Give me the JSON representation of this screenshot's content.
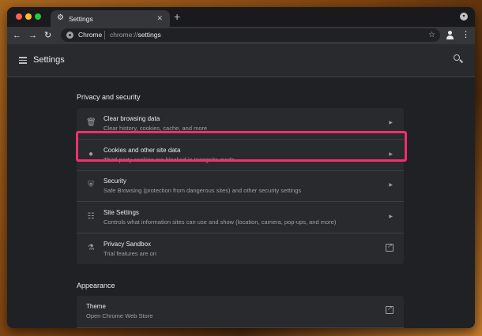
{
  "tab": {
    "title": "Settings",
    "icon": "gear-icon",
    "close_icon": "close-icon"
  },
  "new_tab_icon": "plus-icon",
  "toolbar": {
    "back_icon": "back-arrow-icon",
    "forward_icon": "forward-arrow-icon",
    "reload_icon": "reload-icon",
    "omnibox_label": "Chrome",
    "url_scheme": "chrome://",
    "url_path": "settings",
    "bookmark_icon": "star-icon",
    "profile_icon": "person-icon",
    "menu_icon": "more-vert-icon"
  },
  "header": {
    "title": "Settings",
    "menu_icon": "hamburger-icon",
    "search_icon": "search-icon"
  },
  "privacy": {
    "title": "Privacy and security",
    "rows": [
      {
        "title": "Clear browsing data",
        "subtitle": "Clear history, cookies, cache, and more",
        "icon": "trash-icon"
      },
      {
        "title": "Cookies and other site data",
        "subtitle": "Third-party cookies are blocked in Incognito mode",
        "icon": "cookie-icon"
      },
      {
        "title": "Security",
        "subtitle": "Safe Browsing (protection from dangerous sites) and other security settings",
        "icon": "shield-icon"
      },
      {
        "title": "Site Settings",
        "subtitle": "Controls what information sites can use and show (location, camera, pop-ups, and more)",
        "icon": "sliders-icon"
      },
      {
        "title": "Privacy Sandbox",
        "subtitle": "Trial features are on",
        "icon": "flask-icon"
      }
    ]
  },
  "appearance": {
    "title": "Appearance",
    "rows": [
      {
        "title": "Theme",
        "subtitle": "Open Chrome Web Store"
      }
    ]
  },
  "highlight_color": "#f0306b",
  "accent_colors": {
    "traffic_red": "#ff5f57",
    "traffic_yellow": "#febc2e",
    "traffic_green": "#28c840"
  }
}
